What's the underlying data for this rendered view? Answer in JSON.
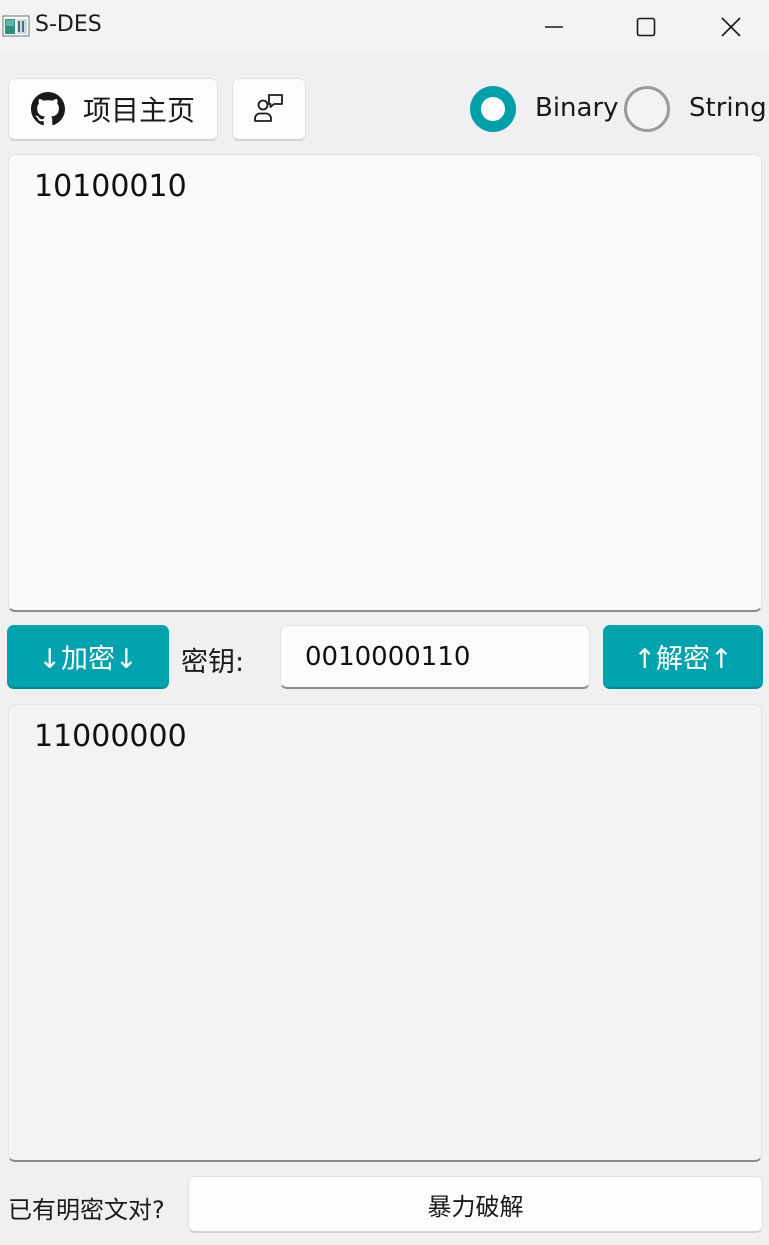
{
  "window": {
    "title": "S-DES",
    "icon": "app-icon",
    "controls": [
      "minimize-icon",
      "maximize-icon",
      "close-icon"
    ]
  },
  "toolbar": {
    "github_label": "项目主页",
    "github_icon": "github-icon",
    "feedback_icon": "feedback-icon"
  },
  "mode": {
    "options": [
      "Binary",
      "String"
    ],
    "selected": "Binary",
    "accent_color": "#00a2ad"
  },
  "plaintext": {
    "value": "10100010"
  },
  "actions": {
    "encrypt_label": "↓加密↓",
    "decrypt_label": "↑解密↑",
    "key_label": "密钥:",
    "key_value": "0010000110"
  },
  "ciphertext": {
    "value": "11000000"
  },
  "bruteforce": {
    "question_label": "已有明密文对?",
    "button_label": "暴力破解"
  }
}
